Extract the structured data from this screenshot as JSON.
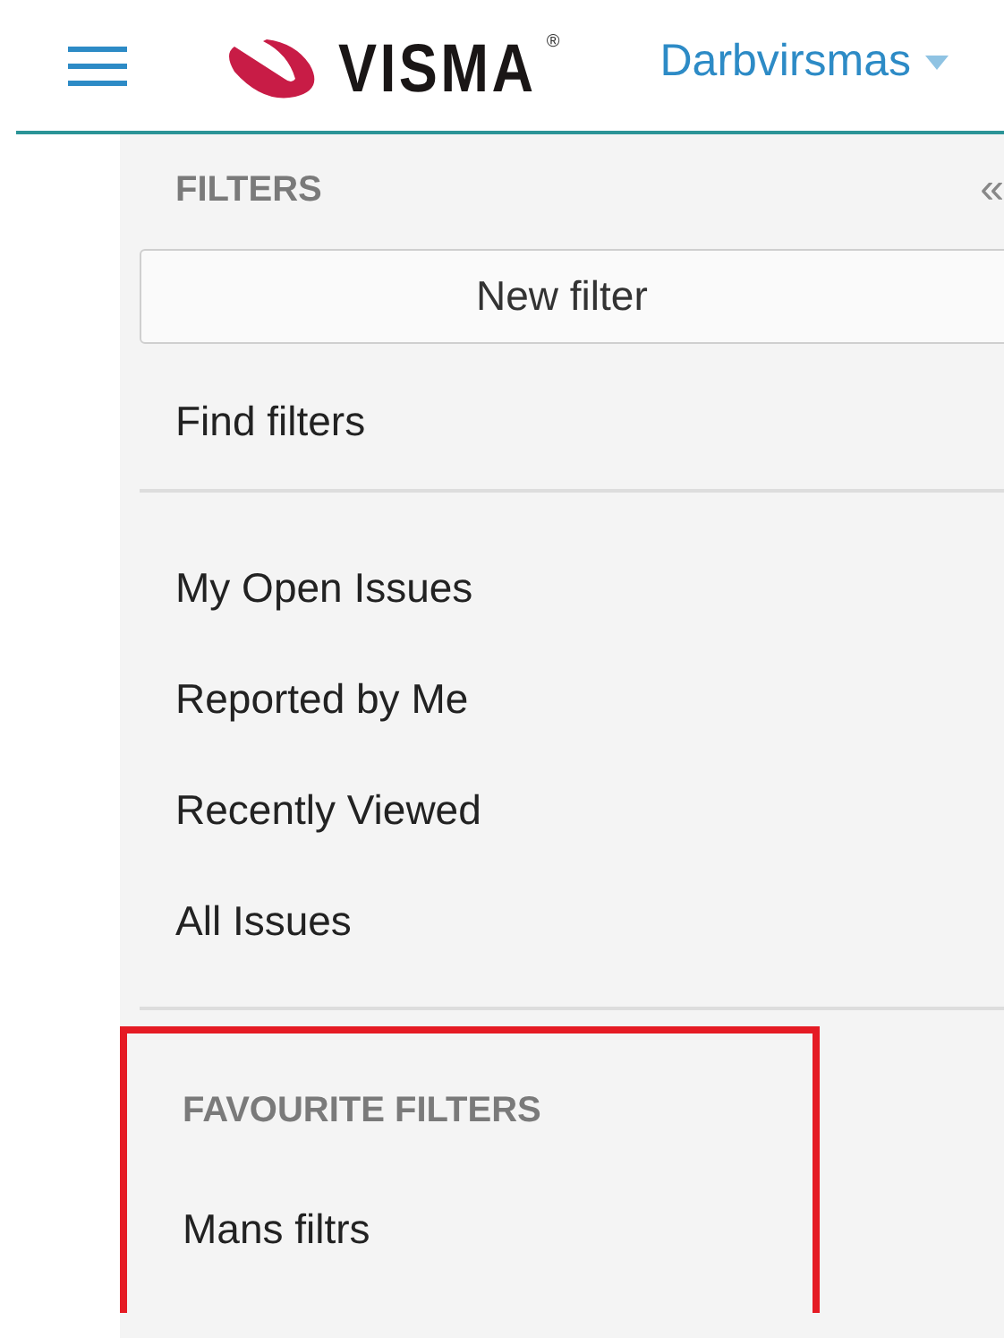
{
  "header": {
    "logo": {
      "wordmark": "VISMA",
      "registered": "®"
    },
    "company": "Darbvirsmas"
  },
  "filters": {
    "title": "FILTERS",
    "collapse": "«",
    "new_button": "New filter",
    "find_link": "Find filters",
    "items": [
      {
        "label": "My Open Issues"
      },
      {
        "label": "Reported by Me"
      },
      {
        "label": "Recently Viewed"
      },
      {
        "label": "All Issues"
      }
    ]
  },
  "favourites": {
    "highlighted": true,
    "title": "FAVOURITE FILTERS",
    "items": [
      {
        "label": "Mans filtrs"
      }
    ]
  }
}
